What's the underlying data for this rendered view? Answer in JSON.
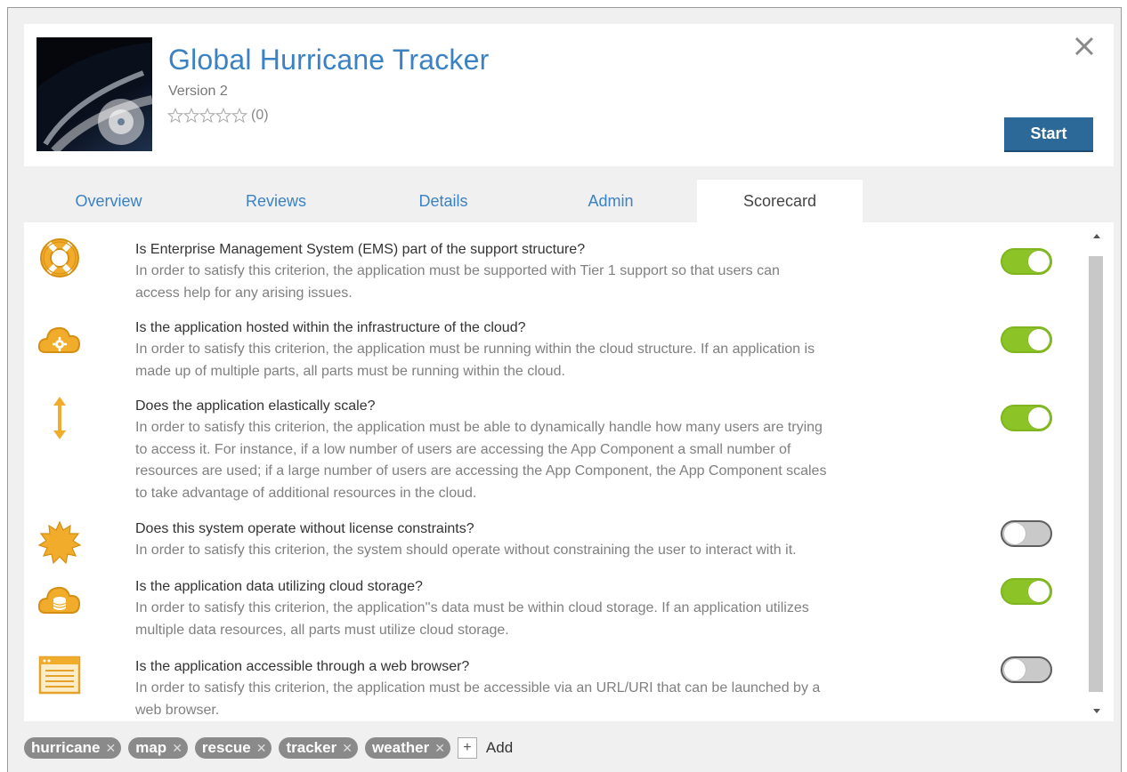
{
  "app": {
    "title": "Global Hurricane Tracker",
    "version": "Version 2",
    "rating_count": "(0)",
    "rating_value": 0,
    "rating_max": 5,
    "start_label": "Start",
    "close_icon": "close-icon",
    "thumbnail": "hurricane-satellite-image"
  },
  "tabs": [
    {
      "label": "Overview",
      "active": false
    },
    {
      "label": "Reviews",
      "active": false
    },
    {
      "label": "Details",
      "active": false
    },
    {
      "label": "Admin",
      "active": false
    },
    {
      "label": "Scorecard",
      "active": true
    }
  ],
  "criteria": [
    {
      "icon": "lifebuoy-icon",
      "question": "Is Enterprise Management System (EMS) part of the support structure?",
      "description_lines": [
        "In order to satisfy this criterion, the application must be supported with Tier 1 support so that users can",
        "access help for any arising issues."
      ],
      "enabled": true
    },
    {
      "icon": "cloud-gear-icon",
      "question": "Is the application hosted within the infrastructure of the cloud?",
      "description_lines": [
        "In order to satisfy this criterion, the application must be running within the cloud structure. If an application is",
        "made up of multiple parts, all parts must be running within the cloud."
      ],
      "enabled": true
    },
    {
      "icon": "vertical-arrows-icon",
      "question": "Does the application elastically scale?",
      "description_lines": [
        "In order to satisfy this criterion, the application must be able to dynamically handle how many users are trying",
        "to access it. For instance, if a low number of users are accessing the App Component a small number of",
        "resources are used; if a large number of users are accessing the App Component, the App Component scales",
        "to take advantage of additional resources in the cloud."
      ],
      "enabled": true
    },
    {
      "icon": "starburst-icon",
      "question": "Does this system operate without license constraints?",
      "description_lines": [
        "In order to satisfy this criterion, the system should operate without constraining the user to interact with it."
      ],
      "enabled": false
    },
    {
      "icon": "cloud-database-icon",
      "question": "Is the application data utilizing cloud storage?",
      "description_lines": [
        "In order to satisfy this criterion, the application''s data must be within cloud storage. If an application utilizes",
        "multiple data resources, all parts must utilize cloud storage."
      ],
      "enabled": true
    },
    {
      "icon": "browser-window-icon",
      "question": "Is the application accessible through a web browser?",
      "description_lines": [
        "In order to satisfy this criterion, the application must be accessible via an URL/URI that can be launched by a",
        "web browser."
      ],
      "enabled": false
    }
  ],
  "tags": [
    "hurricane",
    "map",
    "rescue",
    "tracker",
    "weather"
  ],
  "add_symbol": "+",
  "add_label": "Add",
  "colors": {
    "accent": "#3b82c4",
    "start_button": "#2c6898",
    "toggle_on": "#8cc427",
    "toggle_off": "#c9c9c9",
    "icon_orange": "#f0a820",
    "tag_bg": "#8a8a8a"
  }
}
